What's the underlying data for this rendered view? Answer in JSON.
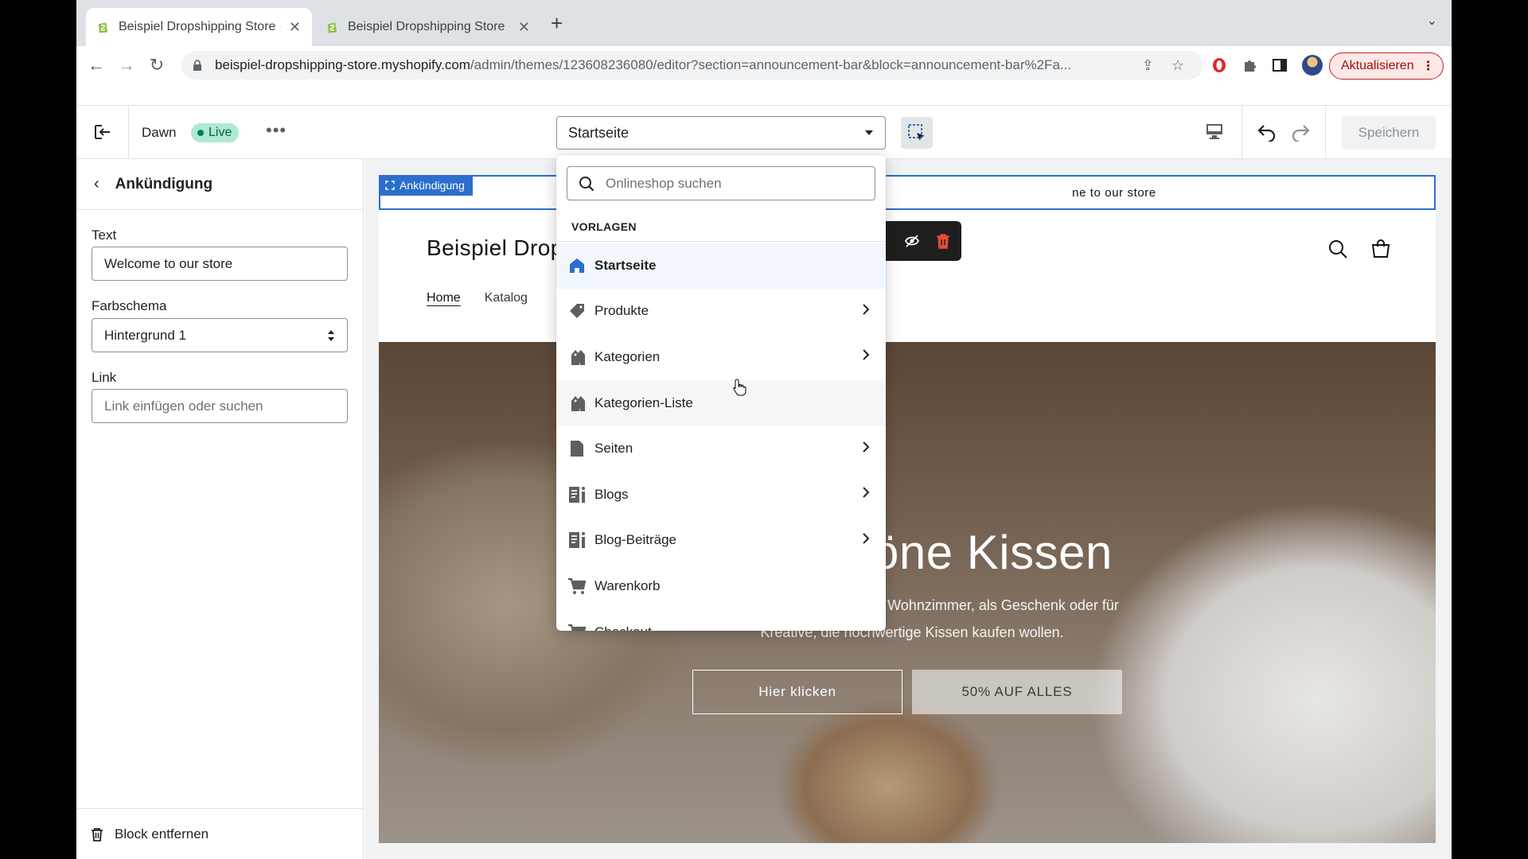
{
  "browser": {
    "tabs": [
      {
        "title": "Beispiel Dropshipping Store · D",
        "active": true
      },
      {
        "title": "Beispiel Dropshipping Store · E",
        "active": false
      }
    ],
    "url_host": "beispiel-dropshipping-store.myshopify.com",
    "url_path": "/admin/themes/123608236080/editor?section=announcement-bar&block=announcement-bar%2Fa...",
    "update_label": "Aktualisieren"
  },
  "editor": {
    "theme_name": "Dawn",
    "live_label": "Live",
    "page_selector_value": "Startseite",
    "save_label": "Speichern"
  },
  "sidebar": {
    "title": "Ankündigung",
    "text_label": "Text",
    "text_value": "Welcome to our store",
    "color_label": "Farbschema",
    "color_value": "Hintergrund 1",
    "link_label": "Link",
    "link_placeholder": "Link einfügen oder suchen",
    "remove_label": "Block entfernen"
  },
  "preview": {
    "announcement_tag": "Ankündigung",
    "announcement_text": "ne to our store",
    "store_logo": "Beispiel Drop",
    "nav": [
      "Home",
      "Katalog"
    ],
    "hero_title": "höne Kissen",
    "hero_sub_line1": "eigene Wohnzimmer, als Geschenk oder für",
    "hero_sub_line2": "Kreative, die hochwertige Kissen kaufen wollen.",
    "button_primary": "Hier klicken",
    "button_secondary": "50% AUF ALLES"
  },
  "dropdown": {
    "search_placeholder": "Onlineshop suchen",
    "section_title": "VORLAGEN",
    "items": [
      {
        "label": "Startseite",
        "icon": "home-icon",
        "chevron": false
      },
      {
        "label": "Produkte",
        "icon": "tag-icon",
        "chevron": true
      },
      {
        "label": "Kategorien",
        "icon": "collection-icon",
        "chevron": true
      },
      {
        "label": "Kategorien-Liste",
        "icon": "collection-icon",
        "chevron": false
      },
      {
        "label": "Seiten",
        "icon": "page-icon",
        "chevron": true
      },
      {
        "label": "Blogs",
        "icon": "blog-icon",
        "chevron": true
      },
      {
        "label": "Blog-Beiträge",
        "icon": "blog-icon",
        "chevron": true
      },
      {
        "label": "Warenkorb",
        "icon": "cart-icon",
        "chevron": false
      },
      {
        "label": "Checkout",
        "icon": "cart-icon",
        "chevron": false
      }
    ]
  },
  "colors": {
    "accent": "#2c6ecb",
    "live_badge": "#aee9d1",
    "update_button": "#c5221f"
  }
}
